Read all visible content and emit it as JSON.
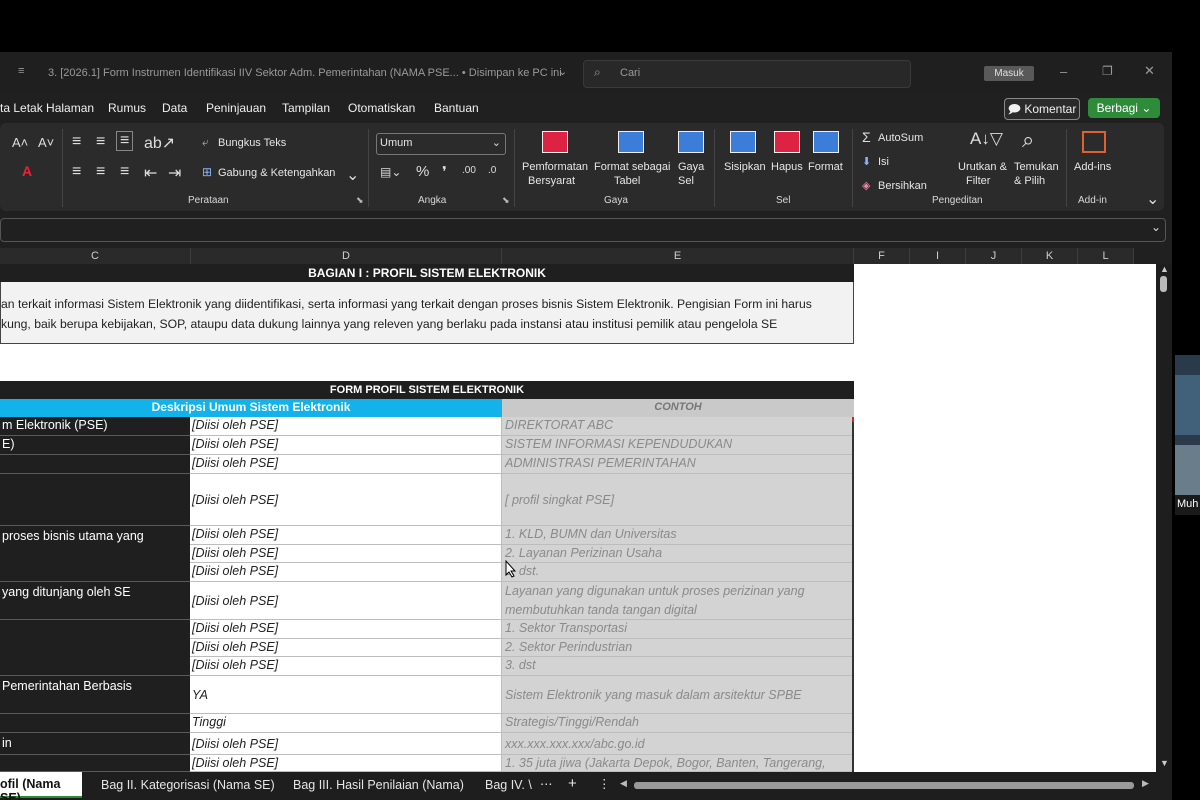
{
  "window": {
    "title": "3. [2026.1] Form Instrumen Identifikasi IIV Sektor Adm. Pemerintahan (NAMA PSE...  •  Disimpan ke PC ini",
    "search_placeholder": "Cari",
    "signin_label": "Masuk"
  },
  "menu": [
    "ta Letak Halaman",
    "Rumus",
    "Data",
    "Peninjauan",
    "Tampilan",
    "Otomatiskan",
    "Bantuan"
  ],
  "actions": {
    "comment_label": "Komentar",
    "share_label": "Berbagi"
  },
  "ribbon": {
    "alignment": {
      "wrap_text": "Bungkus Teks",
      "merge_center": "Gabung & Ketengahkan",
      "group_label": "Perataan"
    },
    "number": {
      "format_value": "Umum",
      "group_label": "Angka"
    },
    "styles": {
      "conditional_1": "Pemformatan",
      "conditional_2": "Bersyarat",
      "format_table_1": "Format sebagai",
      "format_table_2": "Tabel",
      "cell_styles_1": "Gaya",
      "cell_styles_2": "Sel",
      "group_label": "Gaya"
    },
    "cells": {
      "insert": "Sisipkan",
      "delete": "Hapus",
      "format": "Format",
      "group_label": "Sel"
    },
    "editing": {
      "autosum": "AutoSum",
      "fill": "Isi",
      "clear": "Bersihkan",
      "sort_1": "Urutkan &",
      "sort_2": "Filter",
      "find_1": "Temukan",
      "find_2": "& Pilih",
      "group_label": "Pengeditan"
    },
    "addins": {
      "label": "Add-ins",
      "group_label": "Add-in"
    }
  },
  "columns": [
    "C",
    "D",
    "E",
    "F",
    "I",
    "J",
    "K",
    "L"
  ],
  "sheet": {
    "section_title": "BAGIAN I : PROFIL SISTEM ELEKTRONIK",
    "intro_line1": "an terkait informasi Sistem Elektronik yang diidentifikasi, serta informasi yang terkait dengan proses bisnis Sistem Elektronik. Pengisian Form ini harus",
    "intro_line2": "kung, baik berupa kebijakan, SOP, ataupu data dukung lainnya yang releven yang berlaku pada instansi atau institusi  pemilik atau pengelola SE",
    "form_title": "FORM PROFIL SISTEM ELEKTRONIK",
    "desc_header": "Deskripsi Umum Sistem Elektronik",
    "example_header": "CONTOH",
    "labels": {
      "r1": "m Elektronik (PSE)",
      "r2": "E)",
      "r5": "proses bisnis utama yang",
      "r8": "yang ditunjang oleh SE",
      "r12": " Pemerintahan Berbasis",
      "r14": "in"
    },
    "inputs": {
      "r1": "[Diisi oleh PSE]",
      "r2": "[Diisi oleh PSE]",
      "r3": "[Diisi oleh PSE]",
      "r4": "[Diisi oleh PSE]",
      "r5": "[Diisi oleh PSE]",
      "r6": "[Diisi oleh PSE]",
      "r7": "[Diisi oleh PSE]",
      "r8": "[Diisi oleh PSE]",
      "r9": "[Diisi oleh PSE]",
      "r10": "[Diisi oleh PSE]",
      "r11": "[Diisi oleh PSE]",
      "r12": "YA",
      "r13": "Tinggi",
      "r14": "[Diisi oleh PSE]",
      "r15": "[Diisi oleh PSE]"
    },
    "examples": {
      "r1": "DIREKTORAT ABC",
      "r2": "SISTEM INFORMASI KEPENDUDUKAN",
      "r3": "ADMINISTRASI PEMERINTAHAN",
      "r4": "[ profil singkat PSE]",
      "r5": "1.   KLD, BUMN dan Universitas",
      "r6": "2.   Layanan Perizinan Usaha",
      "r7": "3.   dst.",
      "r8": "Layanan yang digunakan untuk proses perizinan yang membutuhkan tanda tangan digital",
      "r9": "1. Sektor Transportasi",
      "r10": "2. Sektor Perindustrian",
      "r11": "3. dst",
      "r12": "Sistem Elektronik yang masuk dalam arsitektur SPBE",
      "r13": "Strategis/Tinggi/Rendah",
      "r14": "xxx.xxx.xxx.xxx/abc.go.id",
      "r15": "1.  35 juta jiwa (Jakarta Depok, Bogor, Banten, Tangerang,"
    }
  },
  "tabs": [
    "ofil (Nama SE)",
    "Bag II. Kategorisasi (Nama SE)",
    "Bag III. Hasil Penilaian (Nama)",
    "Bag IV. \\"
  ],
  "participant_label": "Muh",
  "colors": {
    "accent_blue": "#14b2ea",
    "share_green": "#2e8b3a",
    "dark_header": "#1f1f1f",
    "example_bg": "#d3d3d3"
  }
}
